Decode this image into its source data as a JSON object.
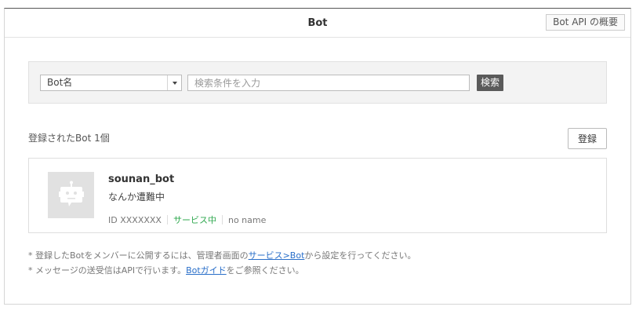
{
  "header": {
    "title": "Bot",
    "overview_button": "Bot API の概要"
  },
  "search": {
    "select_value": "Bot名",
    "input_placeholder": "検索条件を入力",
    "search_button": "検索"
  },
  "list": {
    "count_label": "登録されたBot 1個",
    "register_button": "登録",
    "bots": [
      {
        "name": "sounan_bot",
        "description": "なんか遭難中",
        "id_text": "ID XXXXXXX",
        "status": "サービス中",
        "owner": "no name"
      }
    ]
  },
  "notes": {
    "line1_prefix": "* 登録したBotをメンバーに公開するには、管理者画面の",
    "line1_link": "サービス>Bot",
    "line1_suffix": "から設定を行ってください。",
    "line2_prefix": "* メッセージの送受信はAPIで行います。",
    "line2_link": "Botガイド",
    "line2_suffix": "をご参照ください。"
  },
  "colors": {
    "status_green": "#2fa84f",
    "link_blue": "#2a6fc9",
    "search_button_bg": "#5a5a5a"
  },
  "icons": {
    "avatar": "robot-icon",
    "dropdown": "chevron-down-icon"
  }
}
